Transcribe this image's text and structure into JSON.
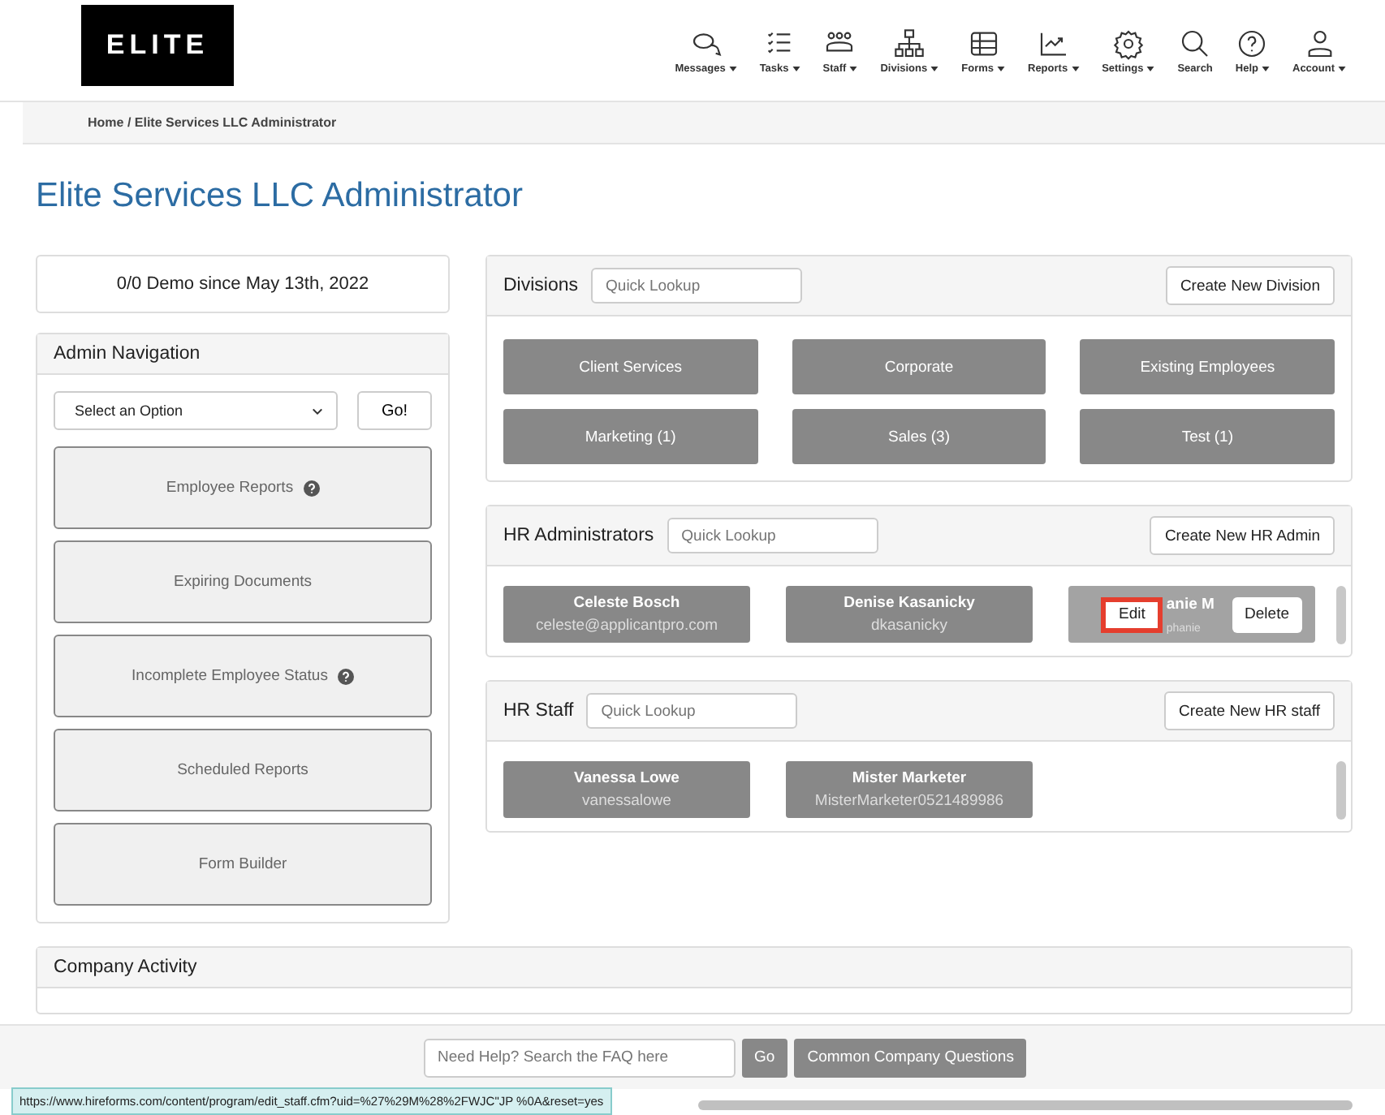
{
  "logo": "ELITE",
  "nav": [
    {
      "label": "Messages",
      "kind": "chat",
      "dropdown": true
    },
    {
      "label": "Tasks",
      "kind": "tasks",
      "dropdown": true
    },
    {
      "label": "Staff",
      "kind": "people",
      "dropdown": true
    },
    {
      "label": "Divisions",
      "kind": "org",
      "dropdown": true
    },
    {
      "label": "Forms",
      "kind": "table",
      "dropdown": true
    },
    {
      "label": "Reports",
      "kind": "chart",
      "dropdown": true
    },
    {
      "label": "Settings",
      "kind": "gear",
      "dropdown": true
    },
    {
      "label": "Search",
      "kind": "search",
      "dropdown": false
    },
    {
      "label": "Help",
      "kind": "help",
      "dropdown": true
    },
    {
      "label": "Account",
      "kind": "user",
      "dropdown": true
    }
  ],
  "breadcrumb": "Home / Elite Services LLC Administrator",
  "page_title": "Elite Services LLC Administrator",
  "demo_status": "0/0 Demo since May 13th, 2022",
  "admin_navigation": {
    "title": "Admin Navigation",
    "select": "Select an Option",
    "go": "Go!",
    "items": [
      {
        "label": "Employee Reports",
        "help": true
      },
      {
        "label": "Expiring Documents",
        "help": false
      },
      {
        "label": "Incomplete Employee Status",
        "help": true
      },
      {
        "label": "Scheduled Reports",
        "help": false
      },
      {
        "label": "Form Builder",
        "help": false
      }
    ]
  },
  "divisions": {
    "title": "Divisions",
    "placeholder": "Quick Lookup",
    "create": "Create New Division",
    "items": [
      "Client Services",
      "Corporate",
      "Existing Employees",
      "Marketing (1)",
      "Sales (3)",
      "Test (1)"
    ]
  },
  "hr_administrators": {
    "title": "HR Administrators",
    "placeholder": "Quick Lookup",
    "create": "Create New HR Admin",
    "people": [
      {
        "name": "Celeste Bosch",
        "login": "celeste@applicantpro.com",
        "hovered": false
      },
      {
        "name": "Denise Kasanicky",
        "login": "dkasanicky",
        "hovered": false
      },
      {
        "name": "anie M",
        "login": "phanie",
        "hovered": true,
        "edit": "Edit",
        "delete": "Delete"
      }
    ]
  },
  "hr_staff": {
    "title": "HR Staff",
    "placeholder": "Quick Lookup",
    "create": "Create New HR staff",
    "people": [
      {
        "name": "Vanessa Lowe",
        "login": "vanessalowe",
        "hovered": false
      },
      {
        "name": "Mister Marketer",
        "login": "MisterMarketer0521489986",
        "hovered": false
      }
    ]
  },
  "company_activity": {
    "title": "Company Activity"
  },
  "help_bar": {
    "placeholder": "Need Help? Search the FAQ here",
    "go": "Go",
    "questions": "Common Company Questions"
  },
  "status_url": "https://www.hireforms.com/content/program/edit_staff.cfm?uid=%27%29M%28%2FWJC\"JP  %0A&reset=yes"
}
